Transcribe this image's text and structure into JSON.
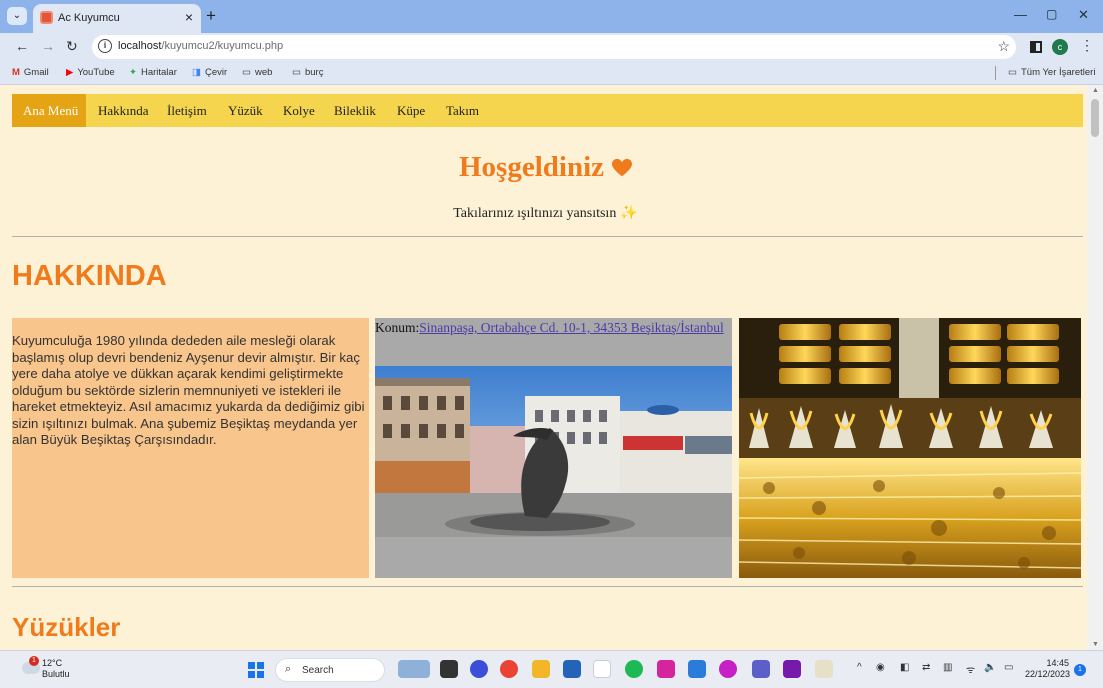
{
  "browser": {
    "tab_title": "Ac Kuyumcu",
    "url_host": "localhost",
    "url_path": "/kuyumcu2/kuyumcu.php",
    "profile_initial": "c",
    "bookmarks": [
      "Gmail",
      "YouTube",
      "Haritalar",
      "Çevir",
      "web",
      "burç"
    ],
    "all_bookmarks": "Tüm Yer İşaretleri"
  },
  "page": {
    "menu": [
      "Ana Menü",
      "Hakkında",
      "İletişim",
      "Yüzük",
      "Kolye",
      "Bileklik",
      "Küpe",
      "Takım"
    ],
    "welcome": "Hoşgeldiniz",
    "subtitle": "Takılarınız ışıltınızı yansıtsın",
    "section_about": "HAKKINDA",
    "about_text": "Kuyumculuğa 1980 yılında dededen aile mesleği olarak başlamış olup devri bendeniz Ayşenur devir almıştır. Bir kaç yere daha atolye ve dükkan açarak kendimi geliştirmekte olduğum bu sektörde sizlerin memnuniyeti ve istekleri ile hareket etmekteyiz. Asıl amacımız yukarda da dediğimiz gibi sizin ışıltınızı bulmak. Ana şubemiz Beşiktaş meydanda yer alan Büyük Beşiktaş Çarşısındadır.",
    "location_label": "Konum:",
    "location_link": "Sinanpaşa, Ortabahçe Cd. 10-1, 34353 Beşiktaş/İstanbul",
    "section_rings": "Yüzükler",
    "accent": "#f07b1d",
    "menu_bg": "#f5d54d",
    "menu_active_bg": "#e5a414"
  },
  "taskbar": {
    "temperature": "12°C",
    "weather": "Bulutlu",
    "weather_badge": "1",
    "search_placeholder": "Search",
    "time": "14:45",
    "date": "22/12/2023",
    "notification_count": "1"
  }
}
